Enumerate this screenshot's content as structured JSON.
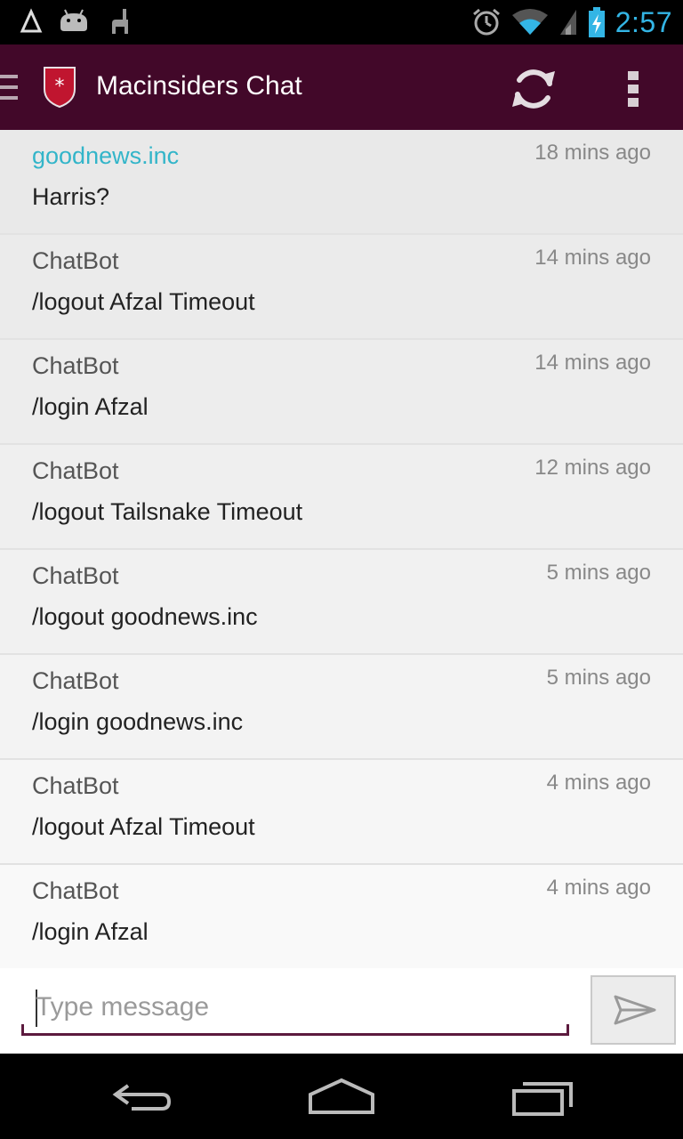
{
  "status_bar": {
    "time": "2:57",
    "left_icons": [
      "delta-icon",
      "android-icon",
      "llama-icon"
    ],
    "right_icons": [
      "alarm-icon",
      "wifi-icon",
      "signal-icon",
      "battery-charging-icon"
    ]
  },
  "header": {
    "title": "Macinsiders Chat",
    "color": "#420829"
  },
  "messages": [
    {
      "author": "goodnews.inc",
      "time": "18 mins ago",
      "text": "Harris?",
      "highlight": true
    },
    {
      "author": "ChatBot",
      "time": "14 mins ago",
      "text": "/logout Afzal Timeout"
    },
    {
      "author": "ChatBot",
      "time": "14 mins ago",
      "text": "/login Afzal"
    },
    {
      "author": "ChatBot",
      "time": "12 mins ago",
      "text": "/logout Tailsnake Timeout"
    },
    {
      "author": "ChatBot",
      "time": "5 mins ago",
      "text": "/logout goodnews.inc"
    },
    {
      "author": "ChatBot",
      "time": "5 mins ago",
      "text": "/login goodnews.inc"
    },
    {
      "author": "ChatBot",
      "time": "4 mins ago",
      "text": "/logout Afzal Timeout"
    },
    {
      "author": "ChatBot",
      "time": "4 mins ago",
      "text": "/login Afzal"
    }
  ],
  "composer": {
    "placeholder": "Type message",
    "value": ""
  },
  "colors": {
    "accent": "#33b5e5",
    "author_highlight": "#33b5c9",
    "header": "#420829"
  }
}
